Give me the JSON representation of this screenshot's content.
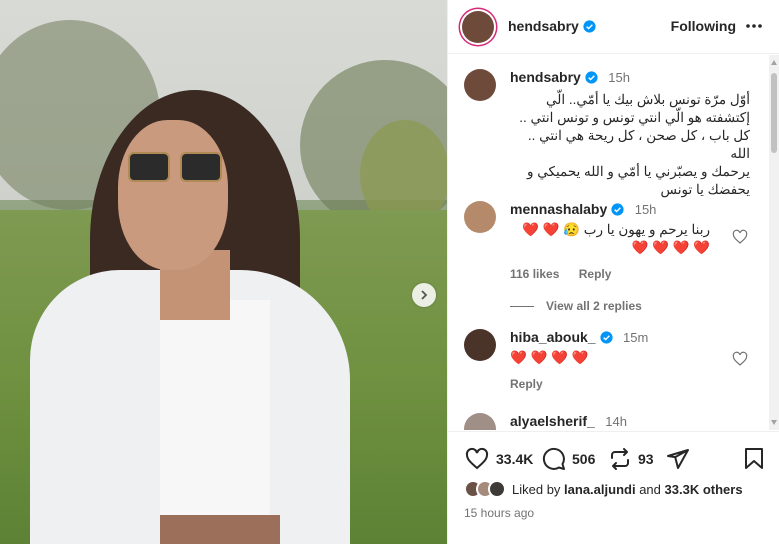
{
  "post_author": {
    "username": "hendsabry",
    "follow_status": "Following"
  },
  "caption": {
    "username": "hendsabry",
    "time": "15h",
    "lines": [
      "أوّل مرّة تونس بلاش بيك يا أمّي.. الّي",
      "إكتشفته هو الّي انتي تونس و تونس انتي ..",
      "كل باب ، كل صحن ، كل ريحة هي انتي .. الله",
      "يرحمك و يصبّرني يا أمّي  و الله يحميكي و",
      "يحفضك يا تونس"
    ]
  },
  "comments": [
    {
      "username": "mennashalaby",
      "time": "15h",
      "text": "ربنا يرحم و يهون يا رب 😥 ❤️ ❤️ ❤️ ❤️ ❤️ ❤️",
      "likes": "116 likes",
      "reply": "Reply",
      "view_replies": "View all 2 replies"
    },
    {
      "username": "hiba_abouk_",
      "time": "15m",
      "text": "❤️ ❤️ ❤️ ❤️",
      "reply": "Reply"
    },
    {
      "username": "alyaelsherif_",
      "time": "14h"
    }
  ],
  "actions": {
    "likes_count": "33.4K",
    "comments_count": "506",
    "reposts_count": "93"
  },
  "liked_by": {
    "prefix": "Liked by",
    "user": "lana.aljundi",
    "and": "and",
    "others": "33.3K others"
  },
  "timestamp": "15 hours ago",
  "colors": {
    "verified_blue": "#0095f6",
    "heart_red": "#ff3040",
    "text_primary": "#262626",
    "text_secondary": "#737373"
  },
  "icons": [
    "chevron-right-icon",
    "more-horizontal-icon",
    "verified-icon",
    "heart-icon",
    "comment-icon",
    "repost-icon",
    "share-icon",
    "bookmark-icon"
  ]
}
